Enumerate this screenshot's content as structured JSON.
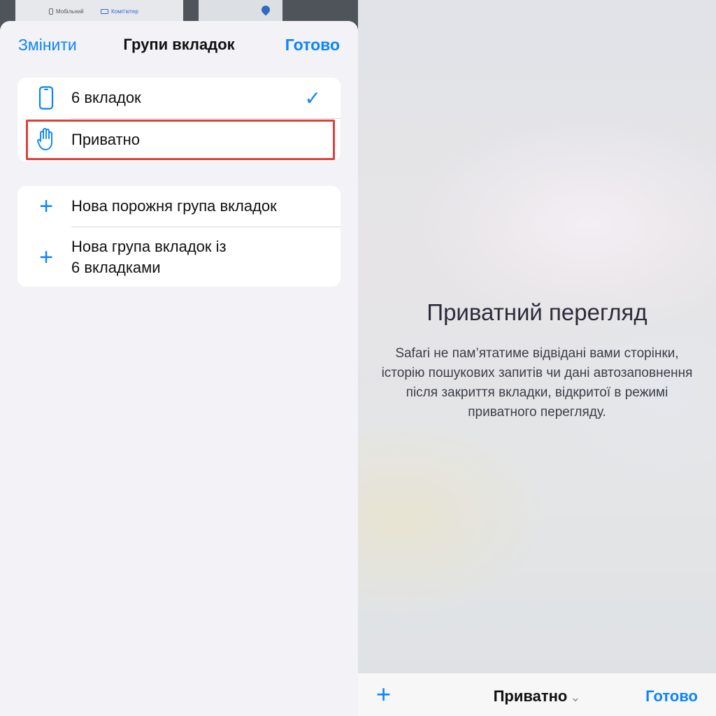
{
  "thumbnails": {
    "tab_mobile_label": "Мобільний",
    "tab_computer_label": "Комп'ютер"
  },
  "sheet": {
    "edit_label": "Змінити",
    "title": "Групи вкладок",
    "done_label": "Готово"
  },
  "groups": {
    "items": [
      {
        "label": "6 вкладок",
        "icon": "phone-icon",
        "selected": true,
        "check": "✓"
      },
      {
        "label": "Приватно",
        "icon": "hand-icon",
        "highlighted": true
      }
    ]
  },
  "actions": {
    "new_empty_label": "Нова порожня група вкладок",
    "new_from_tabs_line1": "Нова група вкладок із",
    "new_from_tabs_line2": "6 вкладками"
  },
  "private_view": {
    "title": "Приватний перегляд",
    "text": "Safari не пам’ятатиме відвідані вами сторінки, історію пошукових запитів чи дані автозаповнення після закриття вкладки, відкритої в режимі приватного перегляду."
  },
  "bottom_bar": {
    "center_label": "Приватно",
    "done_label": "Готово"
  },
  "colors": {
    "accent": "#0a84ff",
    "highlight_border": "#e0403a"
  }
}
